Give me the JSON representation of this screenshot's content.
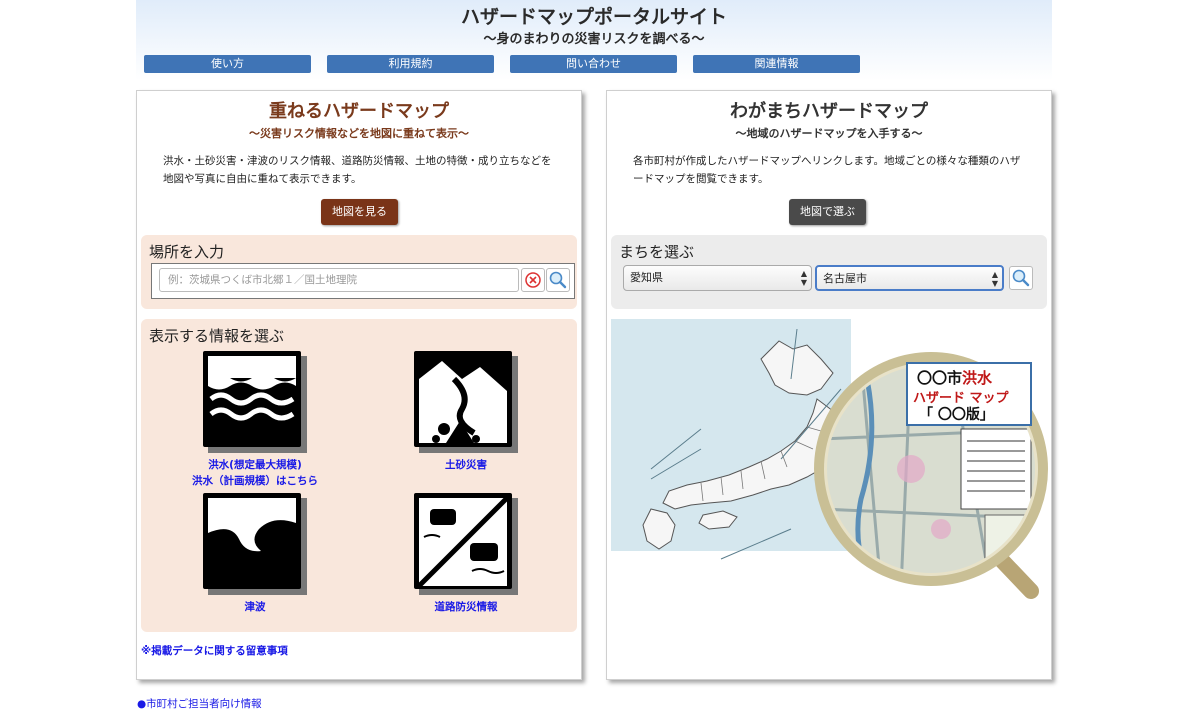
{
  "header": {
    "title": "ハザードマップポータルサイト",
    "subtitle": "〜身のまわりの災害リスクを調べる〜",
    "nav": [
      "使い方",
      "利用規約",
      "問い合わせ",
      "関連情報"
    ]
  },
  "left_panel": {
    "title": "重ねるハザードマップ",
    "subtitle": "〜災害リスク情報などを地図に重ねて表示〜",
    "description": "洪水・土砂災害・津波のリスク情報、道路防災情報、土地の特徴・成り立ちなどを地図や写真に自由に重ねて表示できます。",
    "map_button": "地図を見る",
    "location_title": "場所を入力",
    "search_placeholder": "例：茨城県つくば市北郷１／国土地理院",
    "info_title": "表示する情報を選ぶ",
    "hazards": {
      "flood_label": "洪水(想定最大規模)",
      "flood_plan_label": "洪水（計画規模）はこちら",
      "landslide_label": "土砂災害",
      "tsunami_label": "津波",
      "road_label": "道路防災情報"
    },
    "notes_link": "※掲載データに関する留意事項"
  },
  "right_panel": {
    "title": "わがまちハザードマップ",
    "subtitle": "〜地域のハザードマップを入手する〜",
    "description": "各市町村が作成したハザードマップへリンクします。地域ごとの様々な種類のハザードマップを閲覧できます。",
    "map_button": "地図で選ぶ",
    "town_title": "まちを選ぶ",
    "prefecture_selected": "愛知県",
    "city_selected": "名古屋市",
    "illustration": {
      "line1": "〇〇市",
      "line1_red": "洪水",
      "line2": "ハザード マップ",
      "line3": "「 〇〇版」"
    }
  },
  "footer": {
    "municipal_link": "●市町村ご担当者向け情報"
  },
  "colors": {
    "nav_blue": "#3f74b6",
    "left_title_brown": "#7a3a1c",
    "left_button": "#7a3418",
    "right_button": "#4a4a4a",
    "link_blue": "#1a1ae6",
    "peach_box": "#f9e7dc",
    "grey_box": "#ececec"
  }
}
